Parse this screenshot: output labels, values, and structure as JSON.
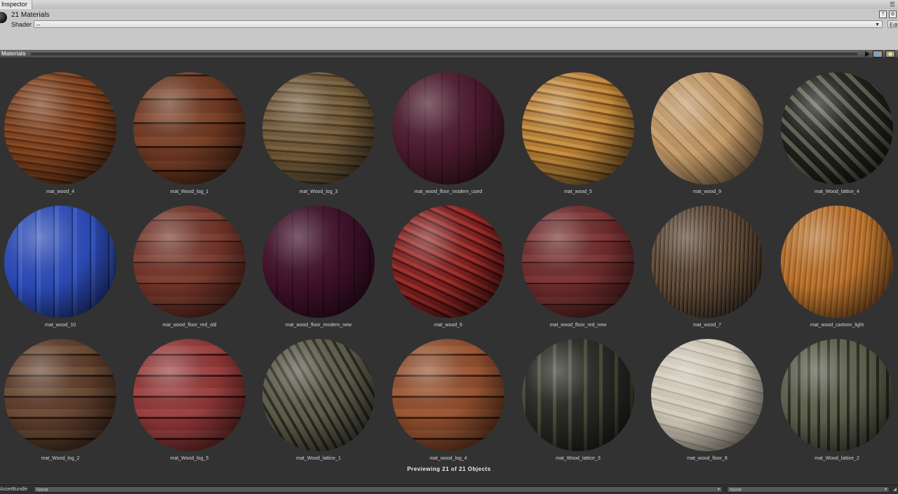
{
  "window": {
    "tab_label": "Inspector"
  },
  "header": {
    "title": "21 Materials",
    "shader_label": "Shader",
    "shader_value": "--",
    "edit_label": "Edit..."
  },
  "preview": {
    "title": "Materials",
    "status": "Previewing 21 of 21 Objects"
  },
  "materials": [
    {
      "name": "mat_wood_4",
      "bg": "repeating-linear-gradient(8deg,#7a3e1c 0 4px,#5a2a12 4px 7px,#8a4a22 7px 10px)"
    },
    {
      "name": "mat_Wood_log_1",
      "bg": "repeating-linear-gradient(0deg,#6a3620 0 18px,#2e160c 18px 21px,#7a4128 21px 34px)"
    },
    {
      "name": "mat_Wood_log_3",
      "bg": "repeating-linear-gradient(4deg,#6b5434 0 6px,#4a3820 6px 9px,#7a6240 9px 14px)"
    },
    {
      "name": "mat_wood_floor_modern_used",
      "bg": "repeating-linear-gradient(90deg,#4a1a2c 0 22px,#3a1222 22px 24px)"
    },
    {
      "name": "mat_wood_5",
      "bg": "repeating-linear-gradient(10deg,#b07a32 0 6px,#7a4e1a 6px 9px,#c89046 9px 14px)"
    },
    {
      "name": "mat_wood_9",
      "bg": "repeating-linear-gradient(45deg,#b89060 0 10px,#9a7448 10px 12px,#c8a070 12px 20px)"
    },
    {
      "name": "mat_Wood_lattice_4",
      "bg": "repeating-linear-gradient(45deg,#5a5e4c 0 6px,#1e1e1a 6px 16px),repeating-linear-gradient(-45deg,#5a5e4c 0 6px,#1e1e1a 6px 16px)"
    },
    {
      "name": "mat_wood_10",
      "bg": "repeating-linear-gradient(90deg,#2a48b0 0 18px,#1a2e78 18px 20px,#3858c0 20px 26px)"
    },
    {
      "name": "mat_wood_floor_red_old",
      "bg": "repeating-linear-gradient(0deg,#6e3228 0 18px,#3a1a14 18px 20px,#7a3e30 20px 30px)"
    },
    {
      "name": "mat_wood_floor_modern_new",
      "bg": "repeating-linear-gradient(90deg,#3e1028 0 20px,#2a0a1c 20px 22px)"
    },
    {
      "name": "mat_wood_6",
      "bg": "repeating-linear-gradient(25deg,#7a1e1e 0 6px,#4a0e0e 6px 9px,#9a2e2a 9px 14px)"
    },
    {
      "name": "mat_wood_floor_red_new",
      "bg": "repeating-linear-gradient(0deg,#6a2a2a 0 18px,#3a1414 18px 20px,#7a3434 20px 30px)"
    },
    {
      "name": "mat_wood_7",
      "bg": "repeating-linear-gradient(92deg,#5a4634 0 2px,#3a2c20 2px 4px,#6a5440 4px 6px)"
    },
    {
      "name": "mat_wood_cartoon_light",
      "bg": "repeating-linear-gradient(95deg,#b06c2a 0 3px,#94561e 3px 5px,#c07a34 5px 8px)"
    },
    {
      "name": "mat_Wood_log_2",
      "bg": "repeating-linear-gradient(0deg,#5a3a28 0 16px,#2a1a12 16px 19px,#6a4a34 19px 30px)"
    },
    {
      "name": "mat_Wood_log_5",
      "bg": "repeating-linear-gradient(0deg,#8a3434 0 16px,#3a1414 16px 19px,#9a4040 19px 30px)"
    },
    {
      "name": "mat_Wood_lattice_1",
      "bg": "repeating-linear-gradient(60deg,#5c5a48 0 8px,#2a2a22 8px 12px)"
    },
    {
      "name": "mat_wood_log_4",
      "bg": "repeating-linear-gradient(0deg,#8a4a2a 0 16px,#3e1e10 16px 19px,#9a5634 19px 30px)"
    },
    {
      "name": "mat_Wood_lattice_3",
      "bg": "repeating-linear-gradient(90deg,#4a4636 0 5px,#262622 5px 22px),repeating-linear-gradient(0deg,#4a4636 0 5px,#262622 5px 22px)"
    },
    {
      "name": "mat_wood_floor_8",
      "bg": "repeating-linear-gradient(15deg,#c8c0b0 0 8px,#aaa294 8px 10px,#d4ccbc 10px 16px)"
    },
    {
      "name": "mat_Wood_lattice_2",
      "bg": "repeating-linear-gradient(90deg,#5a5e4a 0 10px,#2a2c22 10px 14px),repeating-linear-gradient(0deg,#5a5e4a 0 10px,#2a2c22 10px 14px)"
    }
  ],
  "bottom": {
    "assetbundle_label": "AssetBundle",
    "bundle_value": "None",
    "variant_value": "None"
  }
}
